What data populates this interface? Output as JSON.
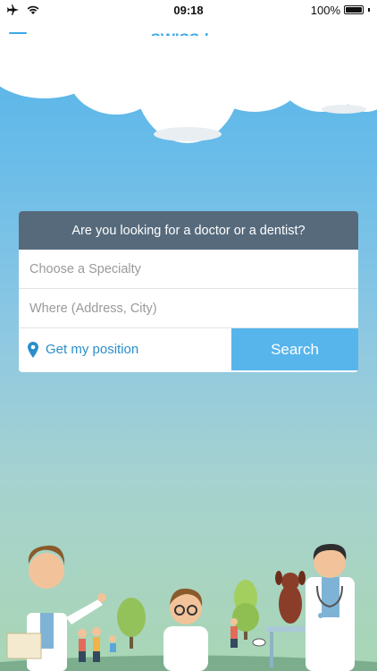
{
  "status_bar": {
    "time": "09:18",
    "battery": "100%",
    "icons": [
      "airplane-icon",
      "wifi-icon",
      "battery-icon"
    ]
  },
  "header": {
    "title": "SWISSdoc",
    "menu_icon": "hamburger-menu-icon"
  },
  "search_card": {
    "question": "Are you looking for a doctor or a dentist?",
    "specialty_placeholder": "Choose a Specialty",
    "location_placeholder": "Where (Address, City)",
    "position_label": "Get my position",
    "position_icon": "location-pin-icon",
    "search_label": "Search"
  },
  "colors": {
    "accent": "#3aa9e4",
    "header_bg": "#566a7c",
    "search_button": "#57b5ec"
  }
}
